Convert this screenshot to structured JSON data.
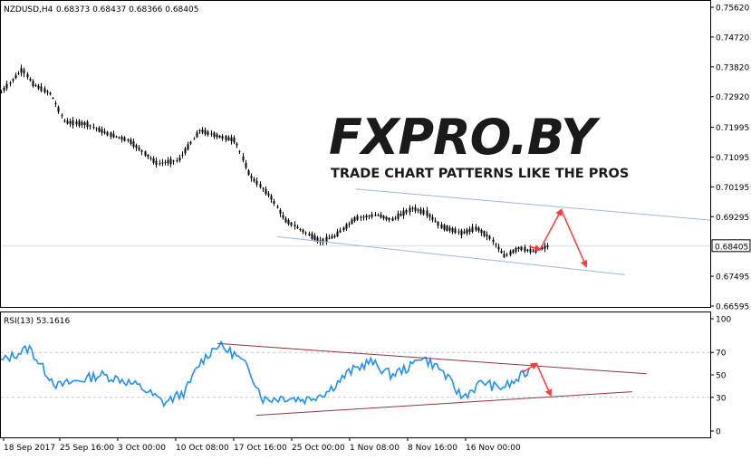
{
  "header": {
    "symbol": "NZDUSD,H4",
    "ohlc": "0.68373 0.68437 0.68366 0.68405"
  },
  "watermark": {
    "brand": "FXPRO.BY",
    "tagline": "TRADE CHART PATTERNS LIKE THE PROS"
  },
  "rsi_header": "RSI(13) 53.1616",
  "colors": {
    "background": "#ffffff",
    "candles": "#000000",
    "price_channel": "#9fb8d6",
    "rsi_line": "#1e90ff",
    "rsi_trendlines": "#8b3a3a",
    "arrows": "#ff3b3b",
    "frame": "#000000"
  },
  "chart_data": [
    {
      "type": "candlestick",
      "title": "NZDUSD,H4",
      "y_tick_labels": [
        "0.75620",
        "0.74720",
        "0.73820",
        "0.72920",
        "0.71995",
        "0.71095",
        "0.70195",
        "0.69295",
        "0.68405",
        "0.67495",
        "0.66595"
      ],
      "current_price_label": "0.68405",
      "ylim": [
        0.66595,
        0.7562
      ],
      "x_tick_labels": [
        "18 Sep 2017",
        "25 Sep 16:00",
        "3 Oct 00:00",
        "10 Oct 08:00",
        "17 Oct 16:00",
        "25 Oct 00:00",
        "1 Nov 08:00",
        "8 Nov 16:00",
        "16 Nov 00:00"
      ],
      "close_path": [
        {
          "x": 0.0,
          "y": 0.7305
        },
        {
          "x": 0.03,
          "y": 0.7375
        },
        {
          "x": 0.045,
          "y": 0.733
        },
        {
          "x": 0.07,
          "y": 0.73
        },
        {
          "x": 0.09,
          "y": 0.7215
        },
        {
          "x": 0.12,
          "y": 0.721
        },
        {
          "x": 0.15,
          "y": 0.718
        },
        {
          "x": 0.18,
          "y": 0.716
        },
        {
          "x": 0.22,
          "y": 0.709
        },
        {
          "x": 0.25,
          "y": 0.71
        },
        {
          "x": 0.28,
          "y": 0.719
        },
        {
          "x": 0.31,
          "y": 0.717
        },
        {
          "x": 0.33,
          "y": 0.716
        },
        {
          "x": 0.35,
          "y": 0.7055
        },
        {
          "x": 0.38,
          "y": 0.699
        },
        {
          "x": 0.4,
          "y": 0.692
        },
        {
          "x": 0.43,
          "y": 0.688
        },
        {
          "x": 0.45,
          "y": 0.6855
        },
        {
          "x": 0.47,
          "y": 0.687
        },
        {
          "x": 0.5,
          "y": 0.6925
        },
        {
          "x": 0.53,
          "y": 0.6935
        },
        {
          "x": 0.55,
          "y": 0.692
        },
        {
          "x": 0.58,
          "y": 0.6955
        },
        {
          "x": 0.6,
          "y": 0.694
        },
        {
          "x": 0.62,
          "y": 0.69
        },
        {
          "x": 0.65,
          "y": 0.688
        },
        {
          "x": 0.67,
          "y": 0.6895
        },
        {
          "x": 0.69,
          "y": 0.6865
        },
        {
          "x": 0.71,
          "y": 0.681
        },
        {
          "x": 0.73,
          "y": 0.6835
        },
        {
          "x": 0.75,
          "y": 0.6825
        },
        {
          "x": 0.77,
          "y": 0.684
        }
      ],
      "channel_upper": [
        {
          "x": 0.5,
          "y": 0.7013
        },
        {
          "x": 1.0,
          "y": 0.6919
        }
      ],
      "channel_lower": [
        {
          "x": 0.39,
          "y": 0.6869
        },
        {
          "x": 0.88,
          "y": 0.6754
        }
      ],
      "forecast_arrows": [
        [
          {
            "x": 0.745,
            "y": 0.684
          },
          {
            "x": 0.76,
            "y": 0.683
          }
        ],
        [
          {
            "x": 0.76,
            "y": 0.683
          },
          {
            "x": 0.79,
            "y": 0.695
          }
        ],
        [
          {
            "x": 0.79,
            "y": 0.695
          },
          {
            "x": 0.825,
            "y": 0.678
          }
        ]
      ]
    },
    {
      "type": "line",
      "title": "RSI(13) 53.1616",
      "series": [
        {
          "name": "RSI(13)",
          "points": [
            {
              "x": 0.0,
              "y": 62
            },
            {
              "x": 0.04,
              "y": 74
            },
            {
              "x": 0.06,
              "y": 55
            },
            {
              "x": 0.08,
              "y": 40
            },
            {
              "x": 0.11,
              "y": 45
            },
            {
              "x": 0.14,
              "y": 50
            },
            {
              "x": 0.17,
              "y": 46
            },
            {
              "x": 0.2,
              "y": 38
            },
            {
              "x": 0.23,
              "y": 25
            },
            {
              "x": 0.26,
              "y": 35
            },
            {
              "x": 0.28,
              "y": 60
            },
            {
              "x": 0.305,
              "y": 77
            },
            {
              "x": 0.33,
              "y": 68
            },
            {
              "x": 0.35,
              "y": 55
            },
            {
              "x": 0.37,
              "y": 28
            },
            {
              "x": 0.4,
              "y": 30
            },
            {
              "x": 0.43,
              "y": 28
            },
            {
              "x": 0.46,
              "y": 35
            },
            {
              "x": 0.49,
              "y": 52
            },
            {
              "x": 0.52,
              "y": 62
            },
            {
              "x": 0.55,
              "y": 50
            },
            {
              "x": 0.58,
              "y": 58
            },
            {
              "x": 0.59,
              "y": 67
            },
            {
              "x": 0.62,
              "y": 55
            },
            {
              "x": 0.65,
              "y": 30
            },
            {
              "x": 0.68,
              "y": 44
            },
            {
              "x": 0.7,
              "y": 38
            },
            {
              "x": 0.72,
              "y": 42
            },
            {
              "x": 0.745,
              "y": 54
            }
          ]
        }
      ],
      "y_tick_labels": [
        "100",
        "70",
        "50",
        "30",
        "0"
      ],
      "ylim": [
        0,
        100
      ],
      "levels": [
        70,
        30
      ],
      "trendline_upper": [
        {
          "x": 0.305,
          "y": 78
        },
        {
          "x": 0.91,
          "y": 51
        }
      ],
      "trendline_lower": [
        {
          "x": 0.36,
          "y": 14
        },
        {
          "x": 0.89,
          "y": 35
        }
      ],
      "forecast_arrows": [
        [
          {
            "x": 0.735,
            "y": 52
          },
          {
            "x": 0.755,
            "y": 60
          }
        ],
        [
          {
            "x": 0.755,
            "y": 60
          },
          {
            "x": 0.775,
            "y": 32
          }
        ]
      ]
    }
  ]
}
